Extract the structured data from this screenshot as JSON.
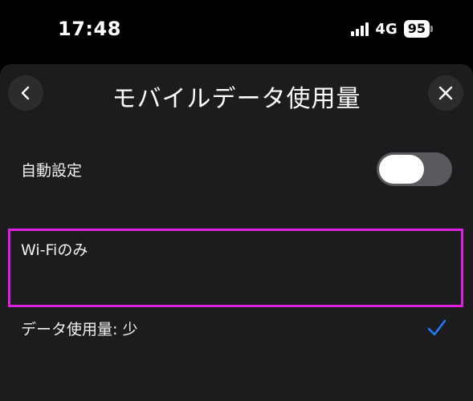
{
  "status_bar": {
    "time": "17:48",
    "network": "4G",
    "battery": "95"
  },
  "header": {
    "title": "モバイルデータ使用量",
    "back_icon": "chevron-left-icon",
    "close_icon": "close-icon"
  },
  "options": {
    "auto": {
      "label": "自動設定",
      "toggle_on": false
    },
    "wifi": {
      "label": "Wi-Fiのみ"
    },
    "low": {
      "label": "データ使用量: 少",
      "selected": true
    }
  },
  "colors": {
    "accent": "#1f7aff",
    "highlight": "#e020e0",
    "sheet_bg": "#1c1c1e"
  }
}
